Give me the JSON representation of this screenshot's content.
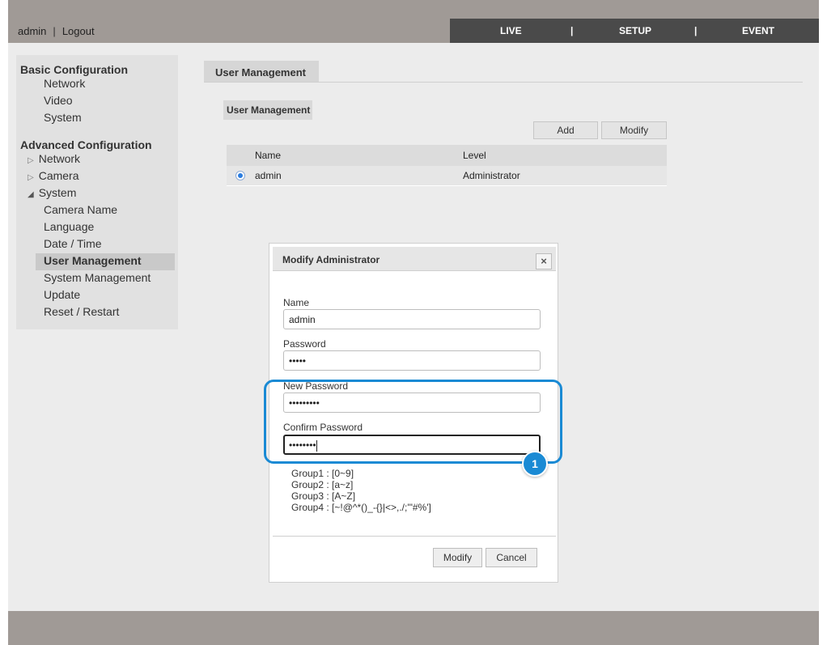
{
  "header": {
    "user": "admin",
    "logout": "Logout",
    "separator": "|",
    "nav": [
      "LIVE",
      "SETUP",
      "EVENT"
    ]
  },
  "sidebar": {
    "basic_title": "Basic Configuration",
    "basic_items": [
      "Network",
      "Video",
      "System"
    ],
    "advanced_title": "Advanced Configuration",
    "advanced_items": [
      "Network",
      "Camera",
      "System"
    ],
    "system_sub": [
      "Camera Name",
      "Language",
      "Date / Time",
      "User Management",
      "System Management",
      "Update",
      "Reset / Restart"
    ],
    "active": "User Management"
  },
  "main": {
    "tab": "User Management",
    "section": "User Management",
    "add_label": "Add",
    "modify_label": "Modify",
    "columns": [
      "Name",
      "Level"
    ],
    "rows": [
      {
        "name": "admin",
        "level": "Administrator"
      }
    ]
  },
  "dialog": {
    "title": "Modify Administrator",
    "close": "×",
    "name_label": "Name",
    "name_value": "admin",
    "password_label": "Password",
    "password_value": "•••••",
    "new_password_label": "New Password",
    "new_password_value": "•••••••••",
    "confirm_label": "Confirm Password",
    "confirm_value": "••••••••",
    "hints": [
      "Group1 : [0~9]",
      "Group2 : [a~z]",
      "Group3 : [A~Z]",
      "Group4 : [~!@^*()_-{}|<>,./;'\"#%']"
    ],
    "modify_label": "Modify",
    "cancel_label": "Cancel"
  },
  "callout": {
    "number": "1",
    "color": "#1a8ad4"
  }
}
